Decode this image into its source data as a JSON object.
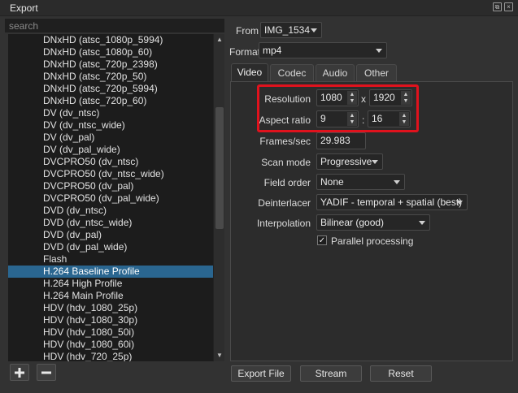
{
  "window": {
    "title": "Export"
  },
  "search": {
    "placeholder": "search"
  },
  "presets": [
    "DNxHD (atsc_1080p_5994)",
    "DNxHD (atsc_1080p_60)",
    "DNxHD (atsc_720p_2398)",
    "DNxHD (atsc_720p_50)",
    "DNxHD (atsc_720p_5994)",
    "DNxHD (atsc_720p_60)",
    "DV (dv_ntsc)",
    "DV (dv_ntsc_wide)",
    "DV (dv_pal)",
    "DV (dv_pal_wide)",
    "DVCPRO50 (dv_ntsc)",
    "DVCPRO50 (dv_ntsc_wide)",
    "DVCPRO50 (dv_pal)",
    "DVCPRO50 (dv_pal_wide)",
    "DVD (dv_ntsc)",
    "DVD (dv_ntsc_wide)",
    "DVD (dv_pal)",
    "DVD (dv_pal_wide)",
    "Flash",
    "H.264 Baseline Profile",
    "H.264 High Profile",
    "H.264 Main Profile",
    "HDV (hdv_1080_25p)",
    "HDV (hdv_1080_30p)",
    "HDV (hdv_1080_50i)",
    "HDV (hdv_1080_60i)",
    "HDV (hdv_720_25p)"
  ],
  "selected_preset": "H.264 Baseline Profile",
  "list_buttons": {
    "add": "+",
    "remove": "−"
  },
  "from": {
    "label": "From",
    "value": "IMG_1534"
  },
  "format": {
    "label": "Format",
    "value": "mp4"
  },
  "tabs": [
    "Video",
    "Codec",
    "Audio",
    "Other"
  ],
  "active_tab": "Video",
  "video": {
    "resolution": {
      "label": "Resolution",
      "width": "1080",
      "separator": "x",
      "height": "1920"
    },
    "aspect_ratio": {
      "label": "Aspect ratio",
      "num": "9",
      "separator": ":",
      "den": "16"
    },
    "frames_per_sec": {
      "label": "Frames/sec",
      "value": "29.983"
    },
    "scan_mode": {
      "label": "Scan mode",
      "value": "Progressive"
    },
    "field_order": {
      "label": "Field order",
      "value": "None"
    },
    "deinterlacer": {
      "label": "Deinterlacer",
      "value": "YADIF - temporal + spatial (best)"
    },
    "interpolation": {
      "label": "Interpolation",
      "value": "Bilinear (good)"
    },
    "parallel_processing": {
      "label": "Parallel processing",
      "checked": true,
      "mark": "✓"
    }
  },
  "actions": {
    "export_file": "Export File",
    "stream": "Stream",
    "reset": "Reset"
  },
  "colors": {
    "selection": "#2a6690",
    "highlight": "#e0121d",
    "background": "#323232"
  }
}
